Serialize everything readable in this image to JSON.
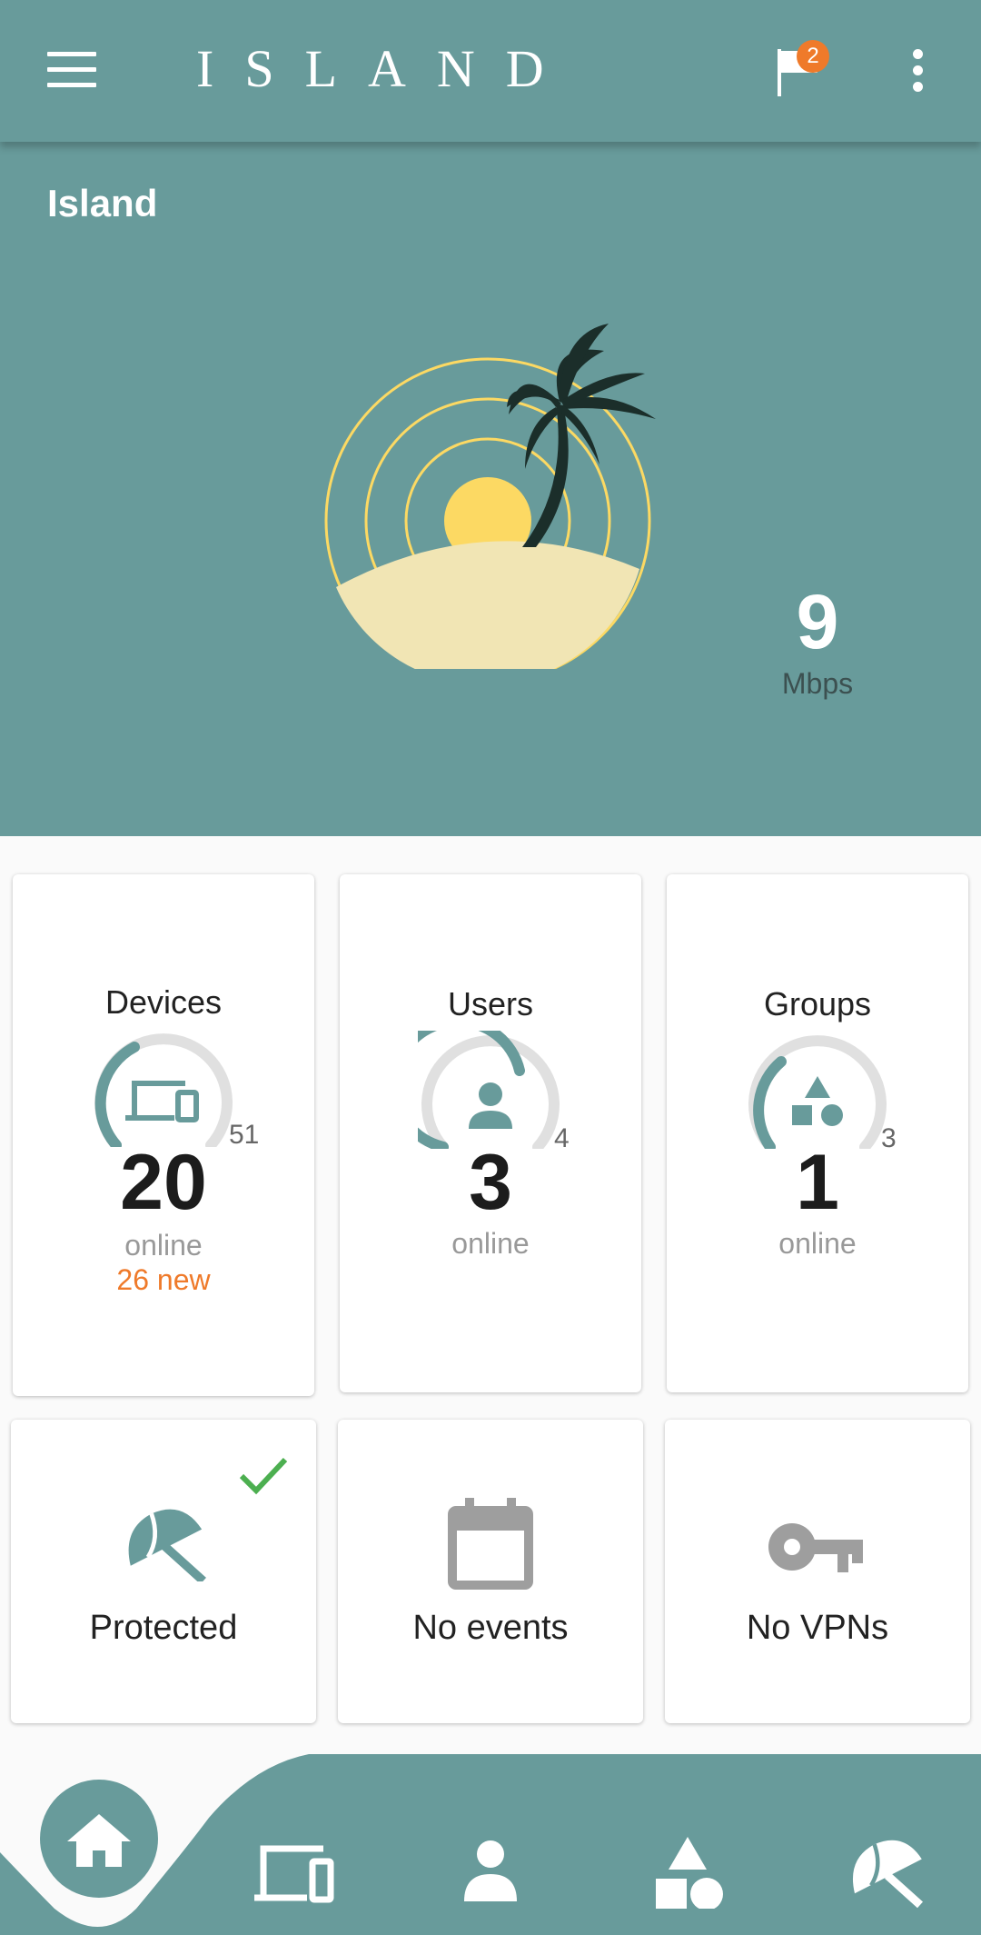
{
  "app": {
    "brand": "ISLAND",
    "notification_count": "2"
  },
  "hero": {
    "title": "Island",
    "speed_value": "9",
    "speed_unit": "Mbps"
  },
  "stats": {
    "devices": {
      "title": "Devices",
      "online": "20",
      "total": "51",
      "online_label": "online",
      "new_label": "26 new"
    },
    "users": {
      "title": "Users",
      "online": "3",
      "total": "4",
      "online_label": "online"
    },
    "groups": {
      "title": "Groups",
      "online": "1",
      "total": "3",
      "online_label": "online"
    }
  },
  "status": {
    "protection": {
      "label": "Protected"
    },
    "events": {
      "label": "No events"
    },
    "vpns": {
      "label": "No VPNs"
    }
  },
  "colors": {
    "primary": "#689b9b",
    "accent": "#ef7a2a",
    "sun": "#fcd963",
    "sand": "#f1e5b4",
    "palm": "#1b2e2a",
    "check": "#4caf50",
    "icon_grey": "#9e9e9e"
  },
  "icons": {
    "nav": [
      "home-icon",
      "devices-icon",
      "user-icon",
      "groups-icon",
      "umbrella-icon"
    ]
  }
}
